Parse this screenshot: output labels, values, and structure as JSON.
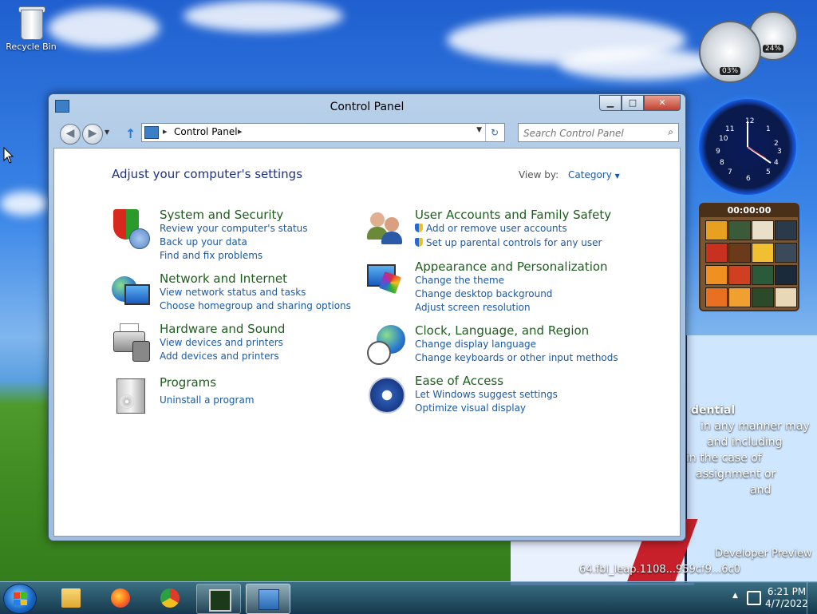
{
  "desktop": {
    "recycle_bin_label": "Recycle Bin",
    "side_text": [
      "dential",
      "in any manner may",
      "and including",
      "in the case of",
      "assignment or",
      "and",
      "Developer Preview",
      "64.fbl_leap.1108...959cf9...6c0"
    ]
  },
  "gadgets": {
    "cpu_gauge": "03%",
    "mem_gauge": "24%",
    "puzzle_timer": "00:00:00"
  },
  "window": {
    "title": "Control Panel",
    "minimize_glyph": "▁",
    "maximize_glyph": "□",
    "close_glyph": "✕",
    "back_glyph": "◀",
    "forward_glyph": "▶",
    "up_glyph": "↑",
    "breadcrumb": "Control Panel",
    "chevron": "▸",
    "dropdown_glyph": "▼",
    "refresh_glyph": "↻",
    "search_placeholder": "Search Control Panel",
    "search_glyph": "⌕"
  },
  "content": {
    "heading": "Adjust your computer's settings",
    "view_by_label": "View by:",
    "view_by_value": "Category",
    "view_by_glyph": "▼",
    "categories": [
      {
        "title": "System and Security",
        "icon": "shield-icon",
        "links": [
          "Review your computer's status",
          "Back up your data",
          "Find and fix problems"
        ]
      },
      {
        "title": "Network and Internet",
        "icon": "network-icon",
        "links": [
          "View network status and tasks",
          "Choose homegroup and sharing options"
        ]
      },
      {
        "title": "Hardware and Sound",
        "icon": "printer-icon",
        "links": [
          "View devices and printers",
          "Add devices and printers"
        ]
      },
      {
        "title": "Programs",
        "icon": "programs-icon",
        "links": [
          "Uninstall a program"
        ]
      },
      {
        "title": "User Accounts and Family Safety",
        "icon": "users-icon",
        "links": [
          "Add or remove user accounts",
          "Set up parental controls for any user"
        ]
      },
      {
        "title": "Appearance and Personalization",
        "icon": "appearance-icon",
        "links": [
          "Change the theme",
          "Change desktop background",
          "Adjust screen resolution"
        ]
      },
      {
        "title": "Clock, Language, and Region",
        "icon": "clock-globe-icon",
        "links": [
          "Change display language",
          "Change keyboards or other input methods"
        ]
      },
      {
        "title": "Ease of Access",
        "icon": "ease-of-access-icon",
        "links": [
          "Let Windows suggest settings",
          "Optimize visual display"
        ]
      }
    ]
  },
  "taskbar": {
    "time": "6:21 PM",
    "date": "4/7/2022",
    "tray_up_glyph": "▲"
  },
  "colors": {
    "title_green": "#1e5e1e",
    "link_blue": "#1a5aa5",
    "heading_blue": "#1e3287"
  }
}
